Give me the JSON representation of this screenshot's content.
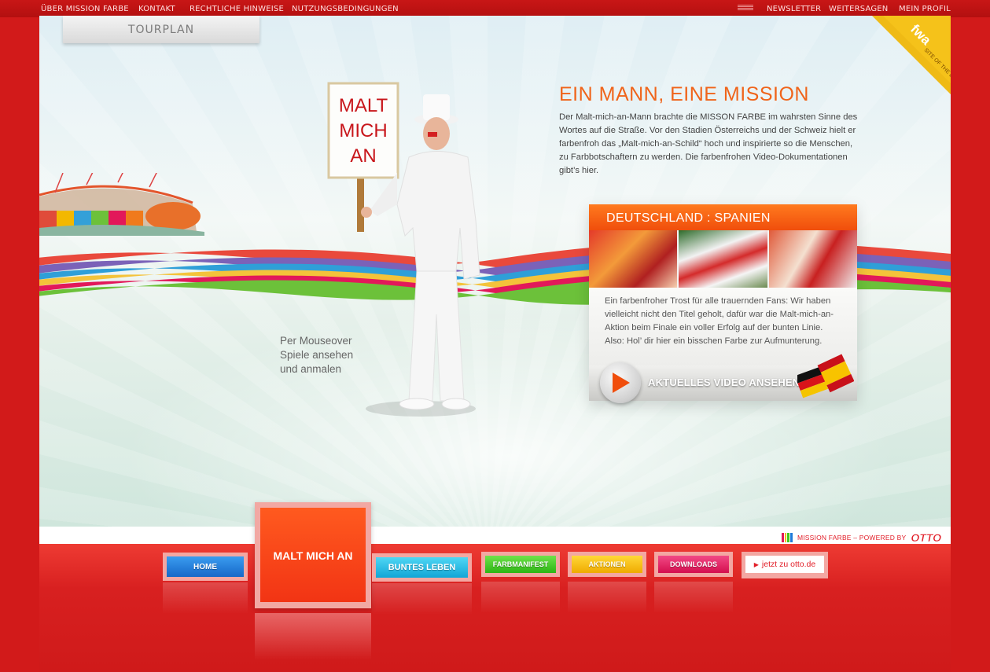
{
  "topnav": {
    "left": [
      "ÜBER MISSION FARBE",
      "KONTAKT",
      "RECHTLICHE HINWEISE",
      "NUTZUNGSBEDINGUNGEN"
    ],
    "right": [
      "NEWSLETTER",
      "WEITERSAGEN",
      "MEIN PROFIL"
    ]
  },
  "tourplan_label": "TOURPLAN",
  "badge": {
    "logo": "fwa",
    "text": "SITE OF THE DAY"
  },
  "hero": {
    "sign_text": [
      "MALT",
      "MICH",
      "AN"
    ],
    "headline": "EIN MANN, EINE MISSION",
    "intro": "Der Malt-mich-an-Mann brachte die MISSON FARBE im wahrsten Sinne des Wortes auf die Straße. Vor den Stadien Österreichs und der Schweiz hielt er farbenfroh das „Malt-mich-an-Schild“ hoch und inspirierte so die Menschen, zu Farbbotschaftern zu werden. Die farbenfrohen Video-Dokumentationen gibt’s hier.",
    "mouseover_hint": [
      "Per Mouseover",
      "Spiele ansehen",
      "und anmalen"
    ]
  },
  "video": {
    "title": "DEUTSCHLAND : SPANIEN",
    "text": "Ein farbenfroher Trost für alle trauernden Fans: Wir haben vielleicht nicht den Titel geholt, dafür war die Malt-mich-an-Aktion beim Finale ein voller Erfolg auf der bunten Linie. Also: Hol’ dir hier ein bisschen Farbe zur Aufmunterung.",
    "cta": "AKTUELLES VIDEO ANSEHEN"
  },
  "footer": {
    "powered_text": "MISSION FARBE – POWERED BY",
    "brand": "OTTO"
  },
  "mainnav": {
    "home": "HOME",
    "malt": "MALT MICH AN",
    "buntes": "BUNTES LEBEN",
    "farbmanifest": "FARBMANIFEST",
    "aktionen": "AKTIONEN",
    "downloads": "DOWNLOADS",
    "otto_link": "jetzt zu otto.de"
  },
  "colors": {
    "accent_orange": "#f04e0c",
    "brand_red": "#e2202a",
    "home": "#1e7bd8",
    "buntes": "#18b6e0",
    "farbmanifest": "#3ec81e",
    "aktionen": "#f3b800",
    "downloads": "#e2185a"
  }
}
